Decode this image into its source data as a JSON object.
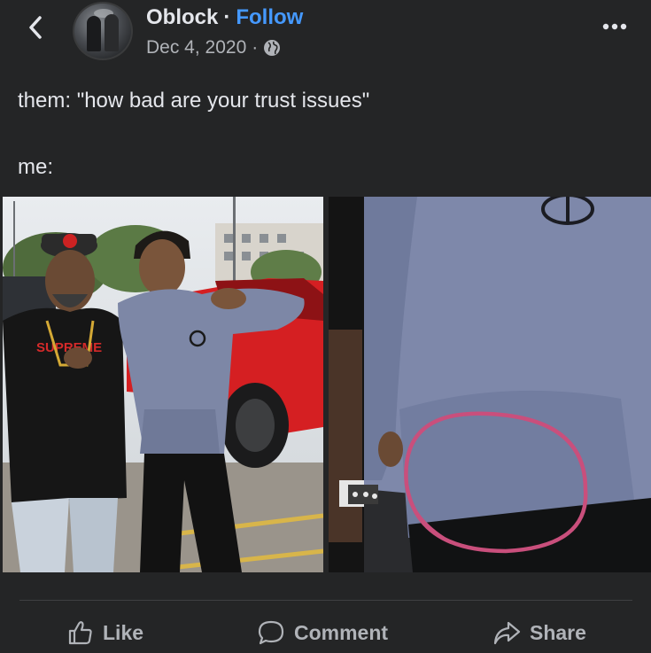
{
  "post": {
    "author": "Oblock",
    "separator": "·",
    "follow_label": "Follow",
    "date": "Dec 4, 2020",
    "meta_separator": "·",
    "privacy_icon": "globe-icon",
    "text_line_1": "them: \"how bad are your trust issues\"",
    "text_line_2": "me:"
  },
  "actions": {
    "like_label": "Like",
    "comment_label": "Comment",
    "share_label": "Share"
  },
  "colors": {
    "background": "#242526",
    "text": "#e4e6eb",
    "secondary_text": "#b0b3b8",
    "link": "#4599ff",
    "annotation_circle": "#c94f7c"
  }
}
